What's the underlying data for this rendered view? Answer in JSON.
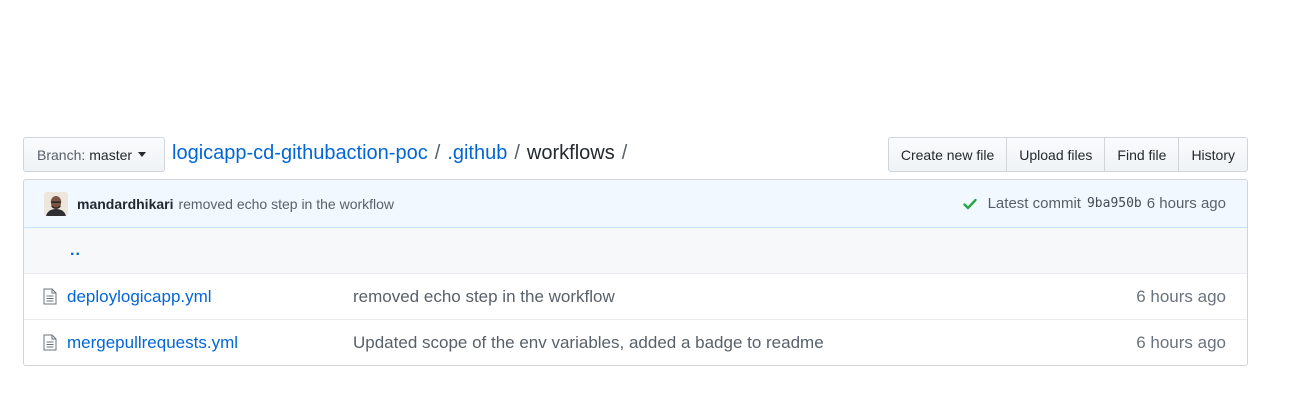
{
  "branch": {
    "prefix": "Branch:",
    "name": "master"
  },
  "breadcrumb": {
    "repo": "logicapp-cd-githubaction-poc",
    "folder": ".github",
    "current": "workflows",
    "separator": "/"
  },
  "actions": {
    "create_new_file": "Create new file",
    "upload_files": "Upload files",
    "find_file": "Find file",
    "history": "History"
  },
  "latest_commit": {
    "author": "mandardhikari",
    "message": "removed echo step in the workflow",
    "label": "Latest commit",
    "sha": "9ba950b",
    "age": "6 hours ago"
  },
  "parent_dir": "..",
  "files": [
    {
      "name": "deploylogicapp.yml",
      "message": "removed echo step in the workflow",
      "age": "6 hours ago"
    },
    {
      "name": "mergepullrequests.yml",
      "message": "Updated scope of the env variables, added a badge to readme",
      "age": "6 hours ago"
    }
  ],
  "colors": {
    "link": "#0366d6",
    "success": "#28a745",
    "commit_bg": "#f1f8ff"
  },
  "icons": [
    "caret-down-icon",
    "avatar",
    "check-icon",
    "file-icon"
  ]
}
